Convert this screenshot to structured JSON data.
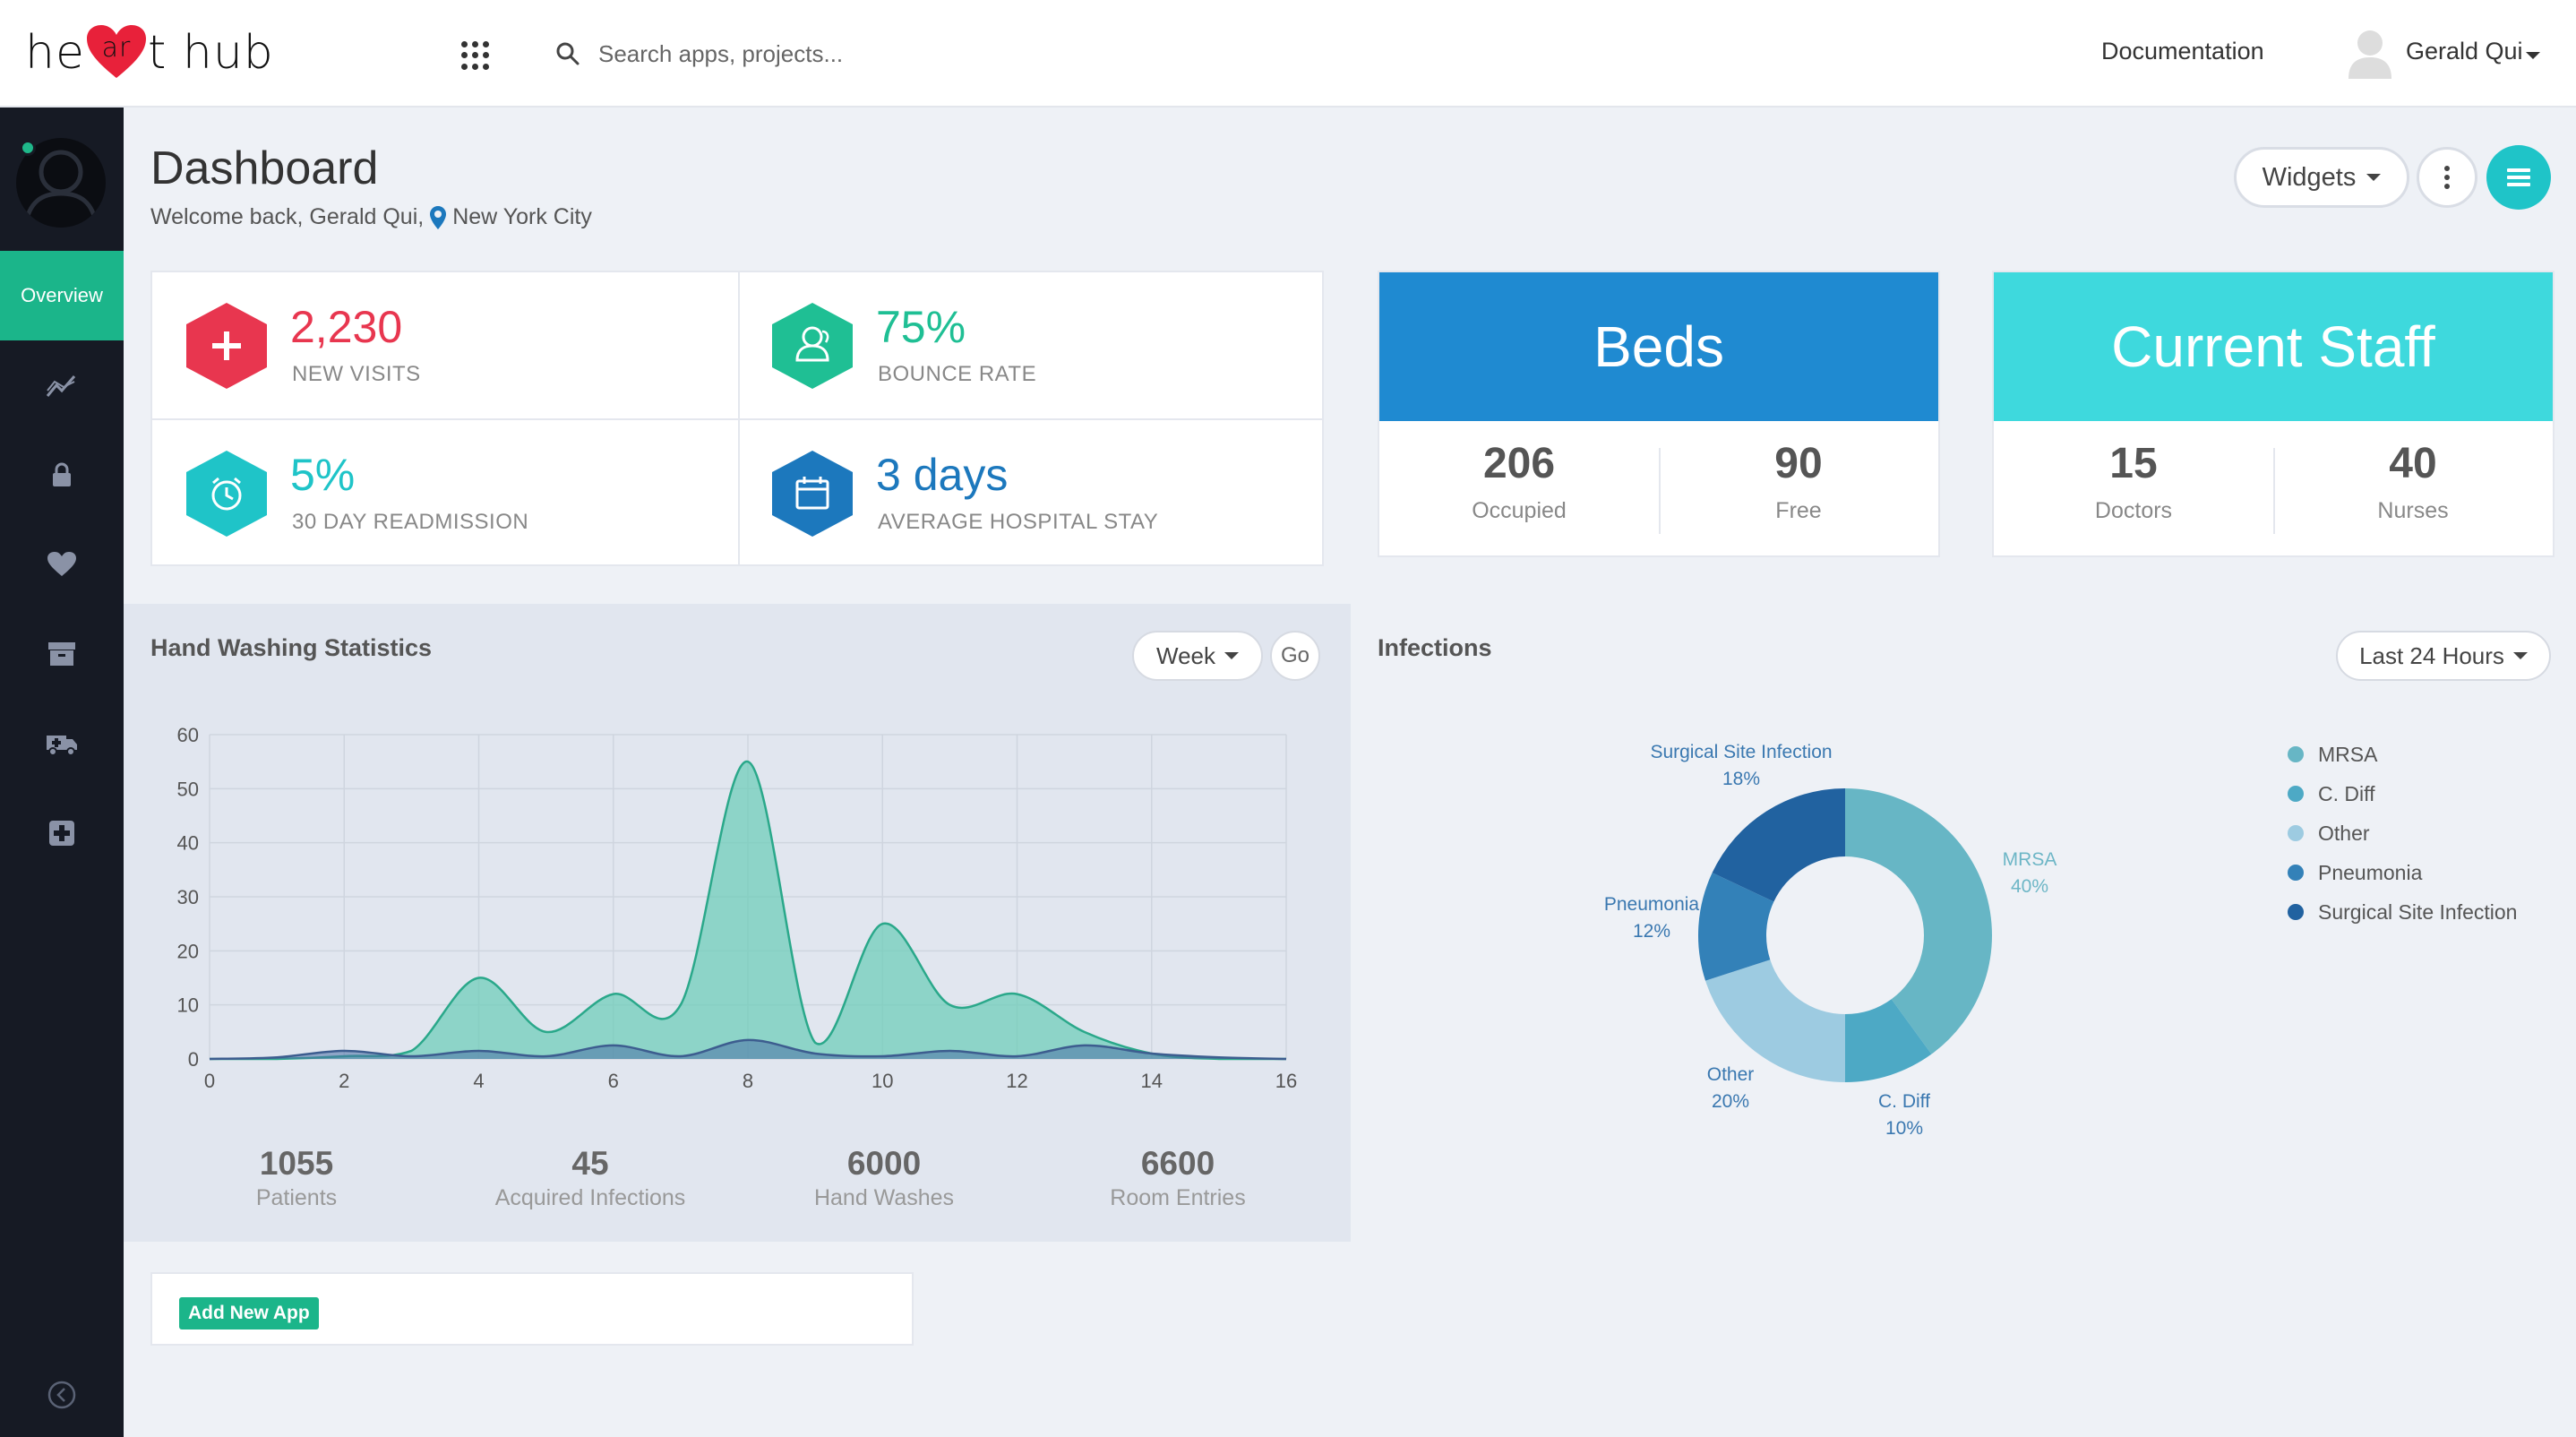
{
  "topbar": {
    "logo_text_left": "he",
    "logo_text_right": "t hub",
    "logo_heart_text": "ar",
    "search_placeholder": "Search apps, projects...",
    "documentation": "Documentation",
    "user_name": "Gerald Qui"
  },
  "sidebar": {
    "overview": "Overview",
    "icons": [
      "chart-line-icon",
      "lock-icon",
      "heart-icon",
      "archive-icon",
      "ambulance-icon",
      "medical-plus-icon"
    ]
  },
  "header": {
    "title": "Dashboard",
    "welcome": "Welcome back, Gerald Qui,",
    "location": "New York City",
    "widgets_label": "Widgets"
  },
  "kpis": [
    {
      "value": "2,230",
      "label": "NEW VISITS",
      "color": "#e8364f",
      "icon": "plus-icon"
    },
    {
      "value": "75%",
      "label": "BOUNCE RATE",
      "color": "#1fbf94",
      "icon": "users-icon"
    },
    {
      "value": "5%",
      "label": "30 DAY READMISSION",
      "color": "#1fc4c8",
      "icon": "alarm-clock-icon"
    },
    {
      "value": "3 days",
      "label": "AVERAGE HOSPITAL STAY",
      "color": "#1c78bd",
      "icon": "calendar-icon"
    }
  ],
  "beds": {
    "title": "Beds",
    "color": "#1f8ad1",
    "occupied_value": "206",
    "occupied_label": "Occupied",
    "free_value": "90",
    "free_label": "Free"
  },
  "staff": {
    "title": "Current Staff",
    "color": "#3ed9dd",
    "doctors_value": "15",
    "doctors_label": "Doctors",
    "nurses_value": "40",
    "nurses_label": "Nurses"
  },
  "hand_washing": {
    "title": "Hand Washing Statistics",
    "period": "Week",
    "go": "Go",
    "stats": [
      {
        "value": "1055",
        "label": "Patients"
      },
      {
        "value": "45",
        "label": "Acquired Infections"
      },
      {
        "value": "6000",
        "label": "Hand Washes"
      },
      {
        "value": "6600",
        "label": "Room Entries"
      }
    ]
  },
  "infections": {
    "title": "Infections",
    "period": "Last 24 Hours"
  },
  "add_app": {
    "label": "Add New App"
  },
  "chart_data": [
    {
      "type": "area",
      "x": [
        0,
        1,
        2,
        3,
        4,
        5,
        6,
        7,
        8,
        9,
        10,
        11,
        12,
        13,
        14,
        15,
        16
      ],
      "series": [
        {
          "values": [
            0,
            0,
            0.5,
            1.5,
            15,
            5,
            12,
            10,
            55,
            3,
            25,
            10,
            12,
            5,
            1,
            0,
            0
          ],
          "color": "#6ccdb8"
        },
        {
          "values": [
            0,
            0.3,
            1.5,
            0.5,
            1.5,
            0.5,
            2.5,
            0.5,
            3.5,
            1,
            0.5,
            1.5,
            0.5,
            2.5,
            1,
            0.3,
            0
          ],
          "color": "#4a6fa5"
        }
      ],
      "xticks": [
        0,
        2,
        4,
        6,
        8,
        10,
        12,
        14,
        16
      ],
      "yticks": [
        0,
        10,
        20,
        30,
        40,
        50,
        60
      ],
      "xlim": [
        0,
        16
      ],
      "ylim": [
        0,
        60
      ],
      "grid": true
    },
    {
      "type": "pie",
      "categories": [
        "MRSA",
        "C. Diff",
        "Other",
        "Pneumonia",
        "Surgical Site Infection"
      ],
      "values": [
        40,
        10,
        20,
        12,
        18
      ],
      "labels": [
        "40%",
        "10%",
        "20%",
        "12%",
        "18%"
      ],
      "colors": [
        "#67b6c5",
        "#4da9c5",
        "#9dcbe1",
        "#3381b8",
        "#2162a0"
      ],
      "legend": "right"
    }
  ]
}
